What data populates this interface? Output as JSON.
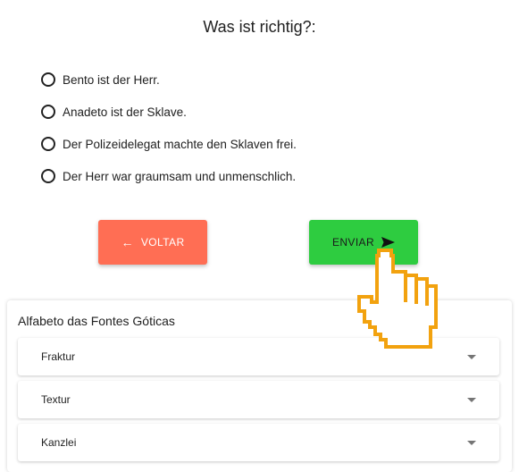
{
  "question": {
    "title": "Was ist richtig?:"
  },
  "options": [
    "Bento ist der Herr.",
    "Anadeto ist der Sklave.",
    "Der Polizeidelegat machte den Sklaven frei.",
    "Der Herr war graumsam und unmenschlich."
  ],
  "buttons": {
    "back_label": "VOLTAR",
    "send_label": "ENVIAR",
    "back_color": "#ff6e54",
    "send_color": "#2ecc40"
  },
  "panel": {
    "title": "Alfabeto das Fontes Góticas",
    "items": [
      {
        "label": "Fraktur"
      },
      {
        "label": "Textur"
      },
      {
        "label": "Kanzlei"
      }
    ]
  },
  "icons": {
    "back": "arrow-left-icon",
    "send": "send-icon",
    "expand": "chevron-down-icon",
    "cursor": "hand-pointer-icon"
  }
}
